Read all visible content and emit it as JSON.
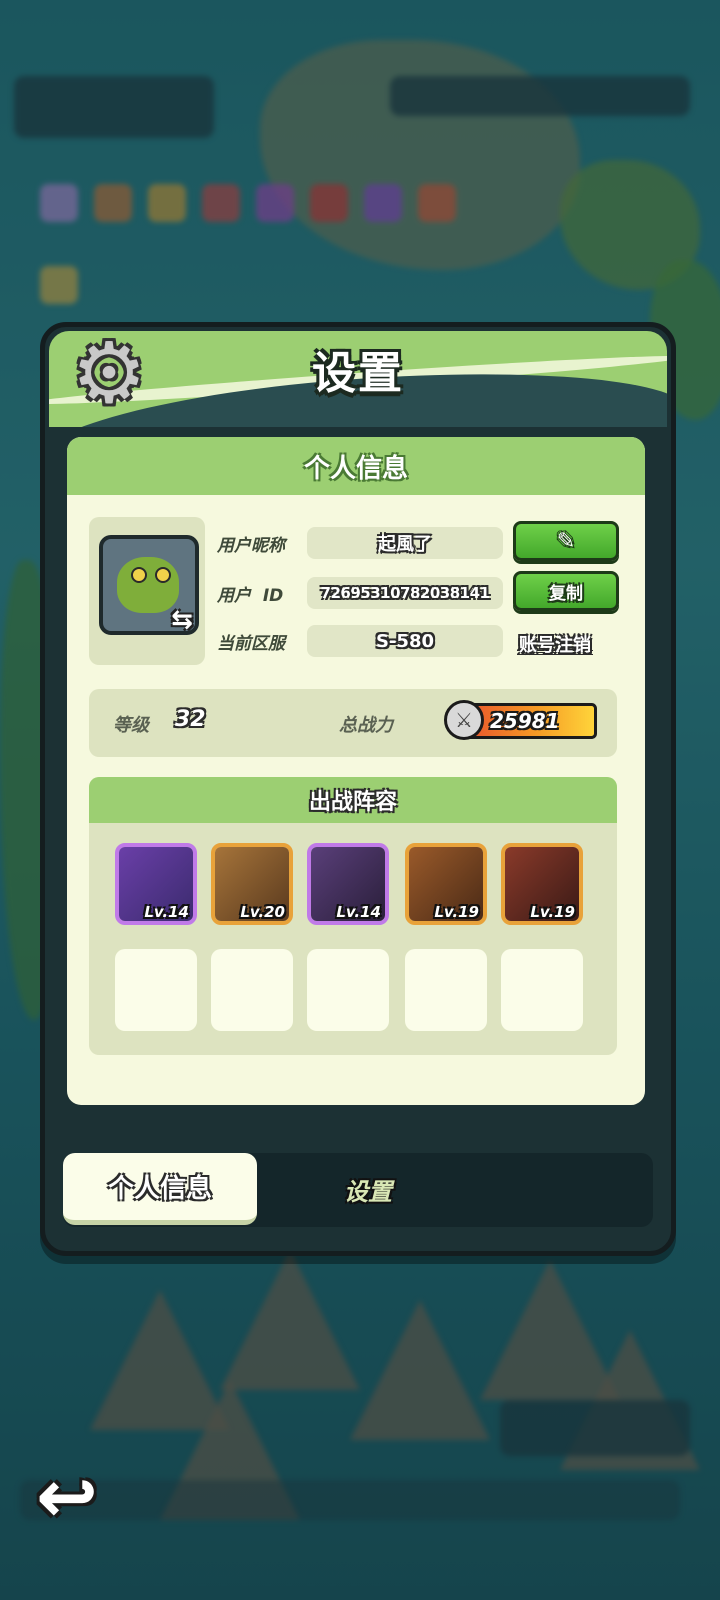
{
  "panel": {
    "title": "设置",
    "gear_icon": "gear-icon"
  },
  "profile": {
    "section_title": "个人信息",
    "nickname_label": "用户昵称",
    "nickname_value": "起風了",
    "id_label": "用户  ID",
    "id_value": "7269531078203814​1",
    "server_label": "当前区服",
    "server_value": "S-580",
    "edit_icon": "pencil-icon",
    "copy_label": "复制",
    "cancel_account_label": "账号注销",
    "swap_icon": "swap-icon"
  },
  "stats": {
    "level_label": "等级",
    "level_value": "32",
    "power_label": "总战力",
    "power_value": "25981",
    "power_icon": "crossed-swords-icon"
  },
  "team": {
    "title": "出战阵容",
    "heroes": [
      {
        "level": "Lv.14",
        "rarity_color": "#c07ae8",
        "art": [
          "#6a3fa8",
          "#3b2b6e"
        ]
      },
      {
        "level": "Lv.20",
        "rarity_color": "#e8a23a",
        "art": [
          "#a6743a",
          "#5a3a1e"
        ]
      },
      {
        "level": "Lv.14",
        "rarity_color": "#c07ae8",
        "art": [
          "#5a3f7a",
          "#2a1f3a"
        ]
      },
      {
        "level": "Lv.19",
        "rarity_color": "#e8a23a",
        "art": [
          "#9a5a2a",
          "#4a2a16"
        ]
      },
      {
        "level": "Lv.19",
        "rarity_color": "#e8a23a",
        "art": [
          "#8a3a2a",
          "#3a1a16"
        ]
      }
    ]
  },
  "tabs": {
    "active": "个人信息",
    "inactive": "设置"
  },
  "colors": {
    "accent_green": "#9ccf72",
    "button_green": "#43a82b",
    "card_bg": "#f6f9de"
  },
  "back_icon": "back-arrow-icon"
}
